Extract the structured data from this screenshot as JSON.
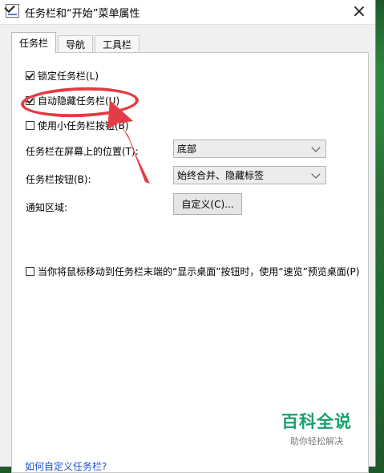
{
  "window": {
    "title": "任务栏和“开始”菜单属性",
    "close_glyph": "×"
  },
  "tabs": [
    {
      "label": "任务栏",
      "active": true
    },
    {
      "label": "导航",
      "active": false
    },
    {
      "label": "工具栏",
      "active": false
    }
  ],
  "taskbar": {
    "options": [
      {
        "label": "锁定任务栏(L)",
        "checked": true
      },
      {
        "label": "自动隐藏任务栏(U)",
        "checked": true
      },
      {
        "label": "使用小任务栏按钮(B)",
        "checked": false
      }
    ],
    "location_label": "任务栏在屏幕上的位置(T):",
    "location_value": "底部",
    "buttons_label": "任务栏按钮(B):",
    "buttons_value": "始终合并、隐藏标签",
    "notification_label": "通知区域:",
    "customize_button": "自定义(C)...",
    "peek_option": {
      "label": "当你将鼠标移动到任务栏末端的“显示桌面”按钮时，使用“速览”预览桌面(P)",
      "checked": false
    },
    "help_link": "如何自定义任务栏?"
  },
  "watermark": {
    "main": "百科全说",
    "sub": "助你轻松解决"
  },
  "colors": {
    "accent_red": "#e43c45",
    "watermark_green": "#18a06b"
  },
  "icons": {
    "app": "taskbar-settings-icon",
    "close": "close-icon",
    "dropdown": "chevron-down-icon",
    "pointer": "red-arrow-icon"
  }
}
